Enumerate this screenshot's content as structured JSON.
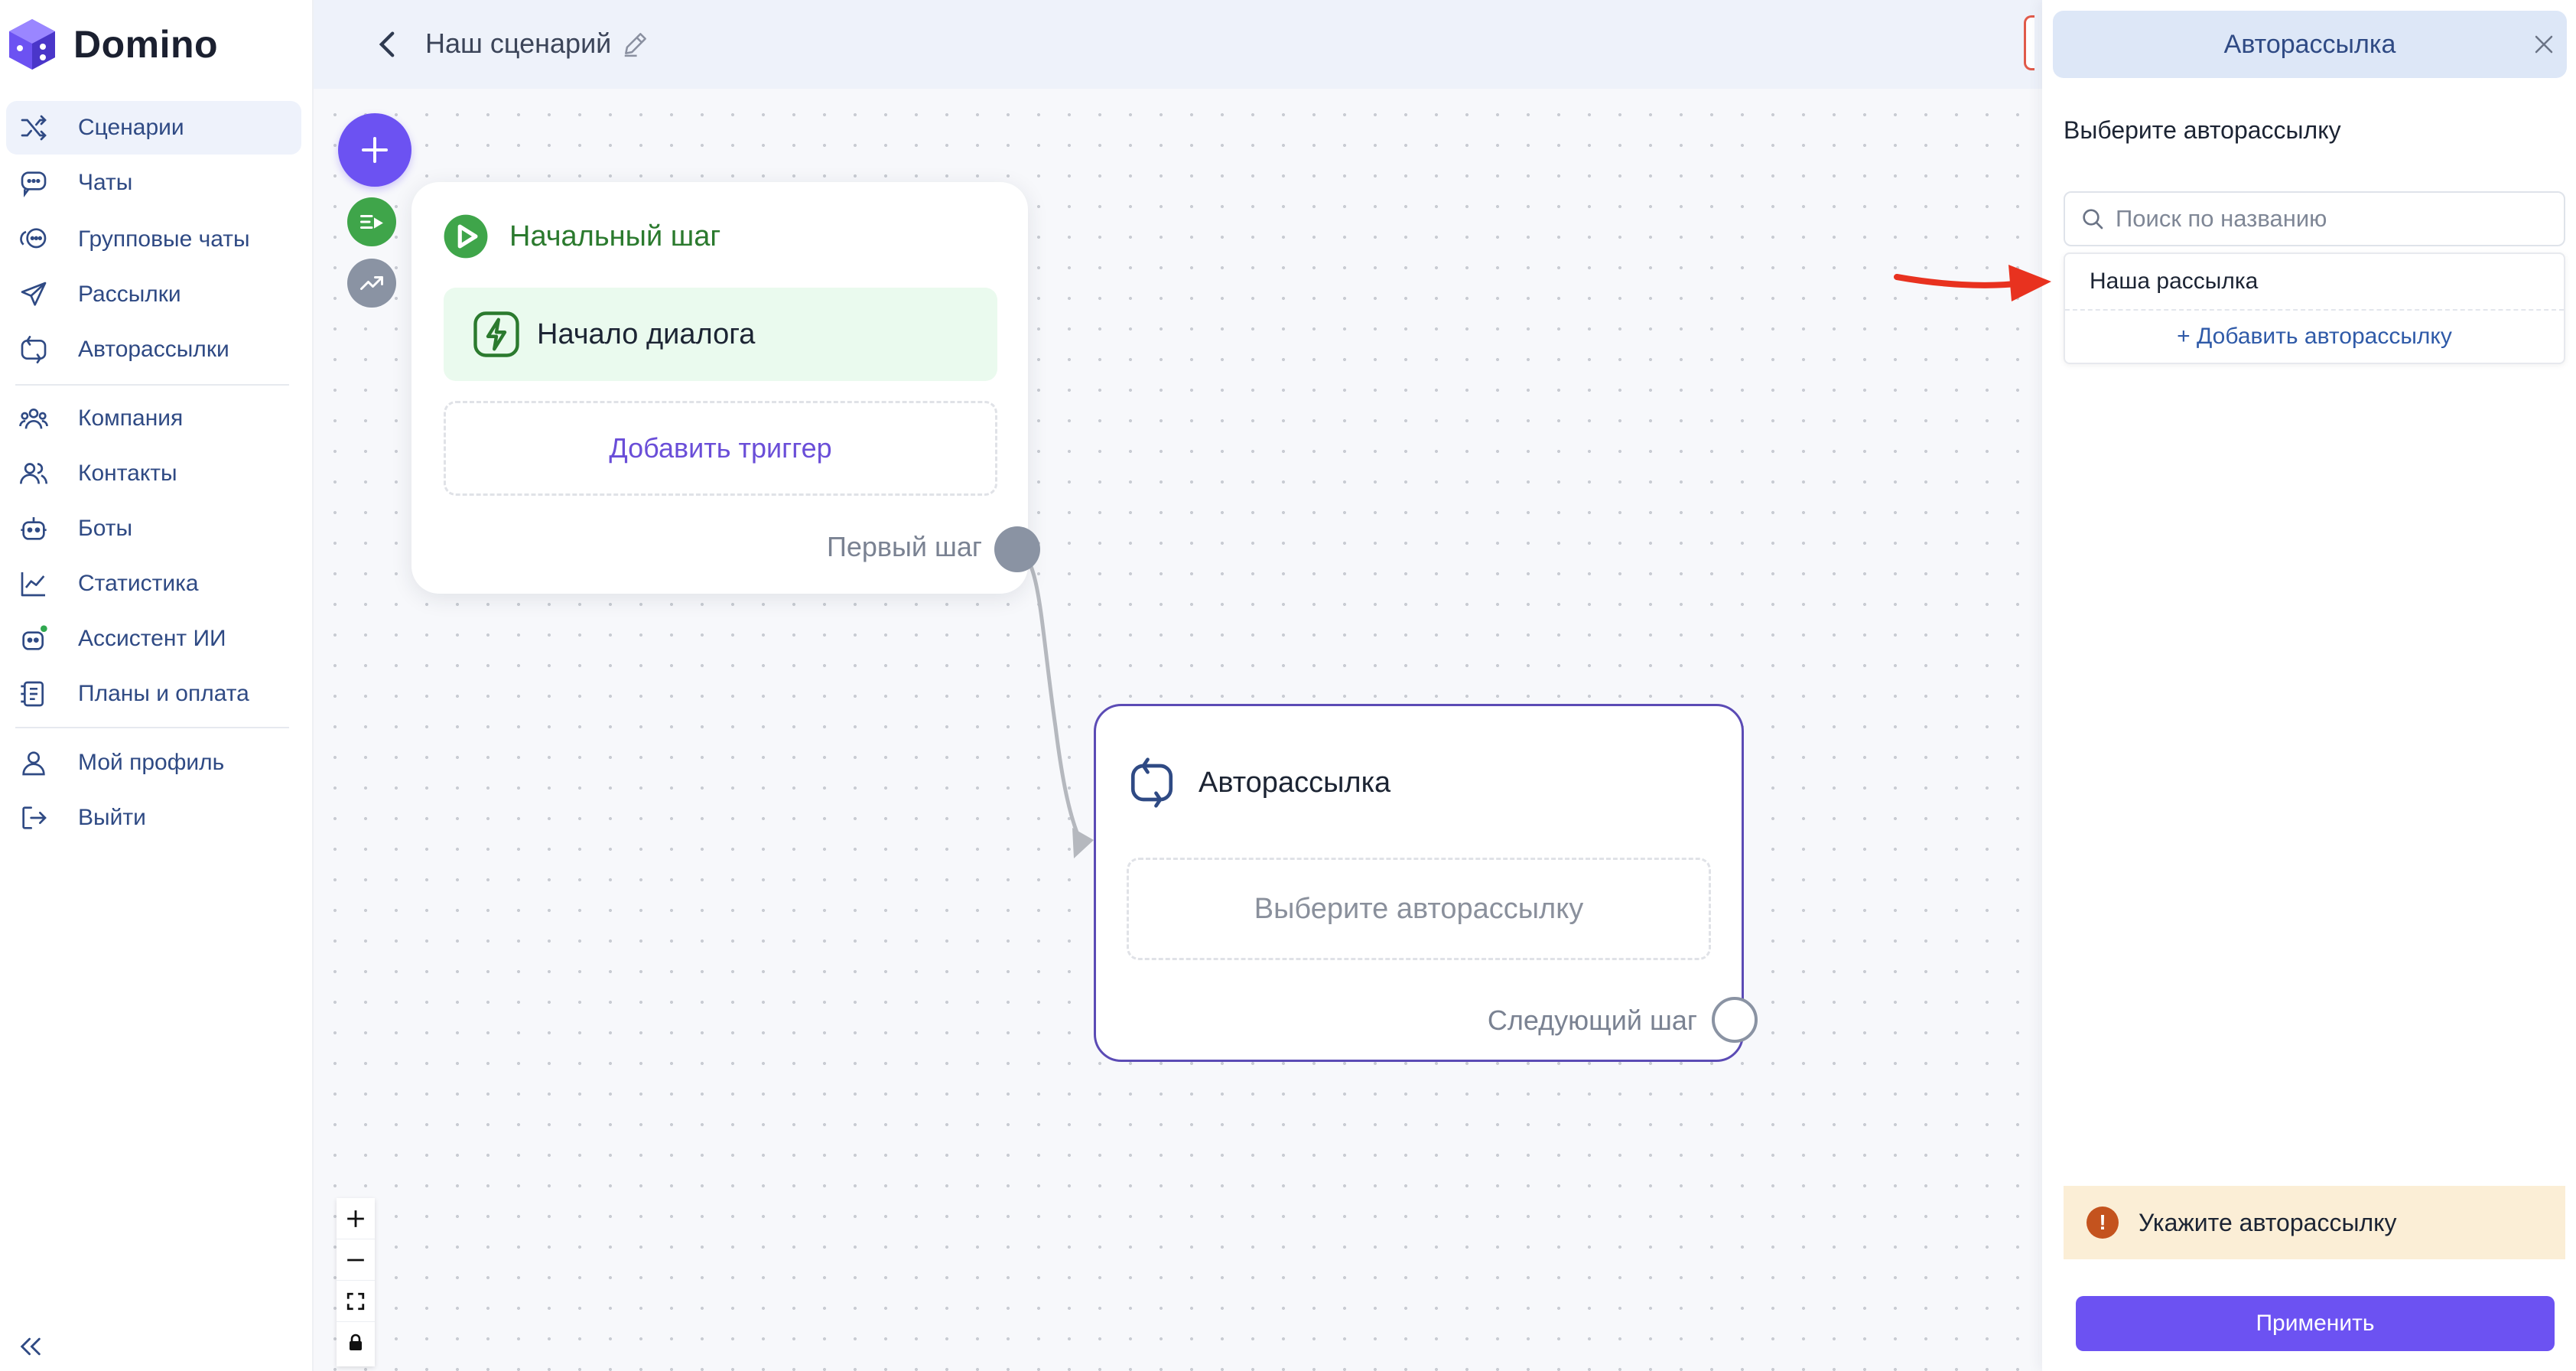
{
  "app": {
    "logo_text": "Domino"
  },
  "sidebar": {
    "items": [
      {
        "label": "Сценарии",
        "icon": "shuffle-icon",
        "active": true
      },
      {
        "label": "Чаты",
        "icon": "chat-icon"
      },
      {
        "label": "Групповые чаты",
        "icon": "group-chat-icon"
      },
      {
        "label": "Рассылки",
        "icon": "send-icon"
      },
      {
        "label": "Авторассылки",
        "icon": "auto-mailing-icon"
      },
      {
        "label": "Компания",
        "icon": "company-icon"
      },
      {
        "label": "Контакты",
        "icon": "contacts-icon"
      },
      {
        "label": "Боты",
        "icon": "bot-icon"
      },
      {
        "label": "Статистика",
        "icon": "chart-icon"
      },
      {
        "label": "Ассистент ИИ",
        "icon": "ai-assistant-icon"
      },
      {
        "label": "Планы и оплата",
        "icon": "billing-icon"
      },
      {
        "label": "Мой профиль",
        "icon": "user-icon"
      },
      {
        "label": "Выйти",
        "icon": "logout-icon"
      }
    ],
    "collapse_icon": "double-chevron-left-icon"
  },
  "header": {
    "title": "Наш сценарий"
  },
  "canvas": {
    "start_node": {
      "title": "Начальный шаг",
      "trigger_label": "Начало диалога",
      "add_trigger_label": "Добавить триггер",
      "output_label": "Первый шаг"
    },
    "auto_node": {
      "title": "Авторассылка",
      "select_placeholder": "Выберите авторассылку",
      "output_label": "Следующий шаг"
    },
    "zoom_controls": [
      "+",
      "−",
      "fit",
      "lock"
    ]
  },
  "panel": {
    "title": "Авторассылка",
    "subtitle": "Выберите авторассылку",
    "search_placeholder": "Поиск по названию",
    "options": [
      "Наша рассылка"
    ],
    "add_option_label": "+ Добавить авторассылку",
    "warning_text": "Укажите авторассылку",
    "apply_label": "Применить"
  },
  "colors": {
    "accent": "#6c52f2",
    "nav_text": "#2f4a84",
    "start_green": "#2b7a2e",
    "warning_bg": "#fbeed6",
    "annotation_arrow": "#e8321f"
  }
}
